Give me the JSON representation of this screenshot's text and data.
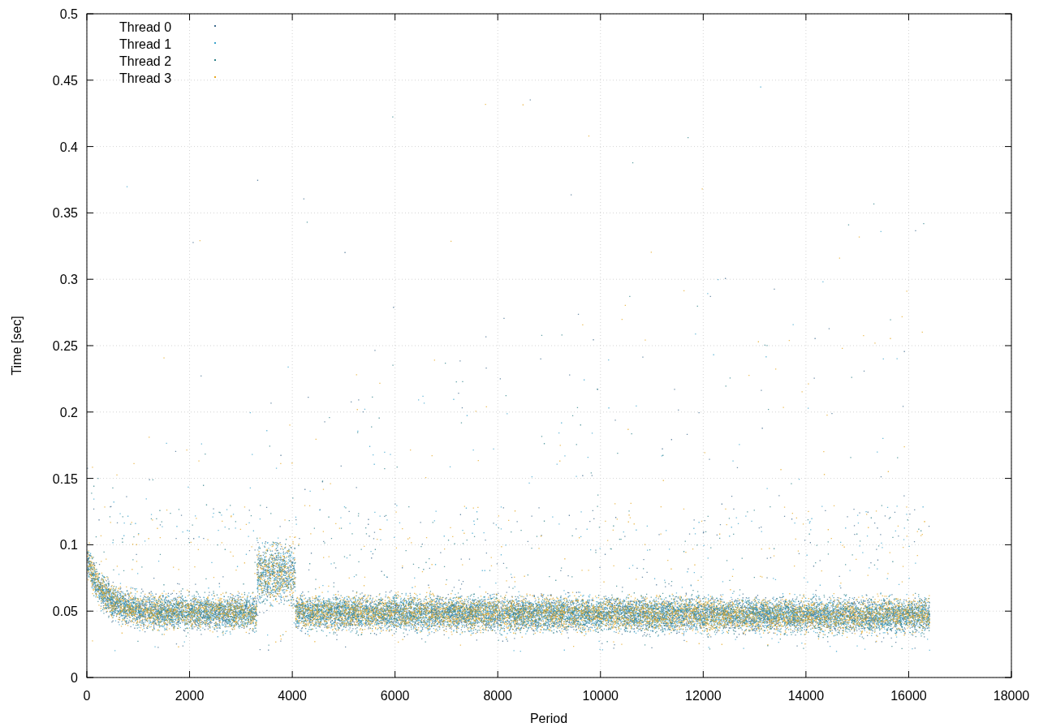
{
  "chart": {
    "xlabel": "Period",
    "ylabel": "Time [sec]",
    "xticks": [
      "0",
      "2000",
      "4000",
      "6000",
      "8000",
      "10000",
      "12000",
      "14000",
      "16000",
      "18000"
    ],
    "yticks": [
      "0.5",
      "0.45",
      "0.4",
      "0.35",
      "0.3",
      "0.25",
      "0.2",
      "0.15",
      "0.1",
      "0.05",
      "0"
    ],
    "legend": [
      {
        "label": "Thread 0",
        "color": "#3d6a8c"
      },
      {
        "label": "Thread 1",
        "color": "#3aa3cc"
      },
      {
        "label": "Thread 2",
        "color": "#2c8088"
      },
      {
        "label": "Thread 3",
        "color": "#e6a823"
      }
    ]
  }
}
